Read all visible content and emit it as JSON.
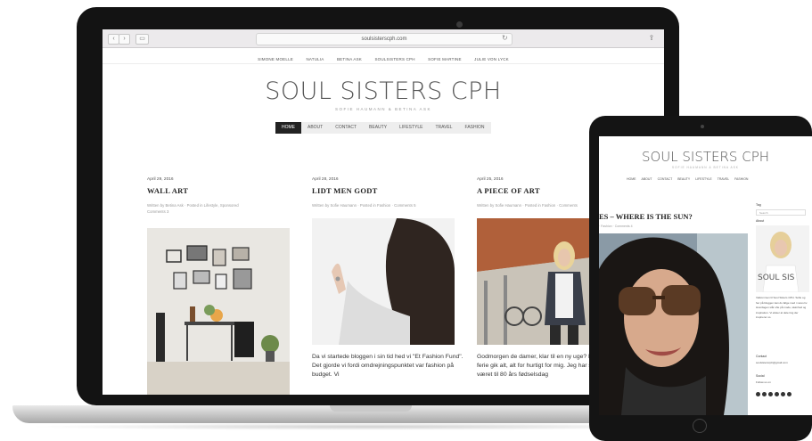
{
  "browser": {
    "url": "soulsisterscph.com",
    "back_label": "‹",
    "forward_label": "›",
    "sidebar_label": "▭",
    "reload_icon": "↻",
    "share_icon": "⇪"
  },
  "sister_links": [
    "SIMONE MOELLE",
    "NATULIA",
    "BETINA ASK",
    "SOULSISTERS CPH",
    "SOFIE MARTINE",
    "JULIE VON LYCK"
  ],
  "site": {
    "title": "SOUL SISTERS CPH",
    "subtitle": "SOFIE HAUMANN & BETINA ASK"
  },
  "main_nav": [
    "HOME",
    "ABOUT",
    "CONTACT",
    "BEAUTY",
    "LIFESTYLE",
    "TRAVEL",
    "FASHION"
  ],
  "posts": [
    {
      "date": "April 29, 2016",
      "title": "WALL ART",
      "meta": "Written by Betina Ask · Posted in Lifestyle, Sponsored",
      "comments": "Comments 3",
      "text": ""
    },
    {
      "date": "April 28, 2016",
      "title": "LIDT MEN GODT",
      "meta": "Written by Sofie Haumann · Posted in Fashion · Comments 5",
      "comments": "",
      "text": "Da vi startede bloggen i sin tid hed vi \"Et Fashion Fund\". Det gjorde vi fordi omdrejningspunktet var fashion på budget. Vi"
    },
    {
      "date": "April 25, 2016",
      "title": "A PIECE OF ART",
      "meta": "Written by Sofie Haumann · Posted in Fashion · Comments",
      "comments": "",
      "text": "Godmorgen de damer, klar til en ny uge? Min her mini ferie gik alt, alt for hurtigt for mig. Jeg har siden fredag været til 80 års fødselsdag"
    }
  ],
  "tablet": {
    "title": "SOUL SISTERS CPH",
    "subtitle": "SOFIE HAUMANN & BETINA ASK",
    "nav": [
      "HOME",
      "ABOUT",
      "CONTACT",
      "BEAUTY",
      "LIFESTYLE",
      "TRAVEL",
      "FASHION"
    ],
    "post_title": "ES – WHERE IS THE SUN?",
    "post_meta": "· Fashion · Comments 4",
    "sidebar": {
      "tag_label": "Tag",
      "search_placeholder": "Search",
      "about_label": "About",
      "about_watermark": "SOUL SIS",
      "about_text": "Velkommen til Soul Sisters CPH. Sofie og her på bloggen kan du følge med i vores liv. Hverdagen står ofte på mode, skønhed og inspiration. Vi elsker at dele ting der inspirerer os.",
      "contact_label": "Contact",
      "contact_email": "soulsisterscph@gmail.com",
      "social_label": "Social",
      "follow_label": "Follow us on"
    }
  },
  "colors": {
    "device_body": "#141414",
    "nav_active": "#222222",
    "nav_bg": "#eeeeee",
    "browser_bar": "#eceaec"
  }
}
